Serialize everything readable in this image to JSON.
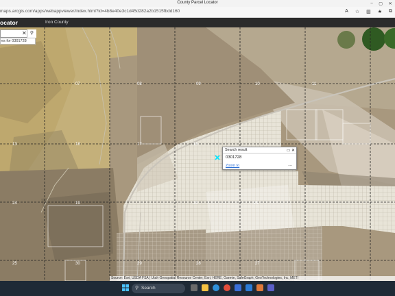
{
  "browser": {
    "title": "County Parcel Locator",
    "url": "maps.arcgis.com/apps/webappviewer/index.html?id=4b8e40e3c1d45d282a2b1515fbdd160"
  },
  "app": {
    "title": "ocator",
    "county": "Iron County"
  },
  "search": {
    "value": "",
    "suggestion": "es for 0301728"
  },
  "popup": {
    "title": "Search result",
    "value": "0301728",
    "zoom_label": "Zoom to",
    "more_label": "..."
  },
  "sections": [
    {
      "label": "07"
    },
    {
      "label": "08"
    },
    {
      "label": "09"
    },
    {
      "label": "10"
    },
    {
      "label": "11"
    },
    {
      "label": "13"
    },
    {
      "label": "18"
    },
    {
      "label": "17"
    },
    {
      "label": "16"
    },
    {
      "label": "24"
    },
    {
      "label": "19"
    },
    {
      "label": "20"
    },
    {
      "label": "21"
    },
    {
      "label": "25"
    },
    {
      "label": "30"
    },
    {
      "label": "29"
    },
    {
      "label": "28"
    },
    {
      "label": "27"
    }
  ],
  "attribution": "Source: Esri, USDA FSA | Utah Geospatial Resource Center, Esri, HERE, Garmin, SafeGraph, GeoTechnologies, Inc, METI",
  "taskbar": {
    "search_label": "Search"
  }
}
